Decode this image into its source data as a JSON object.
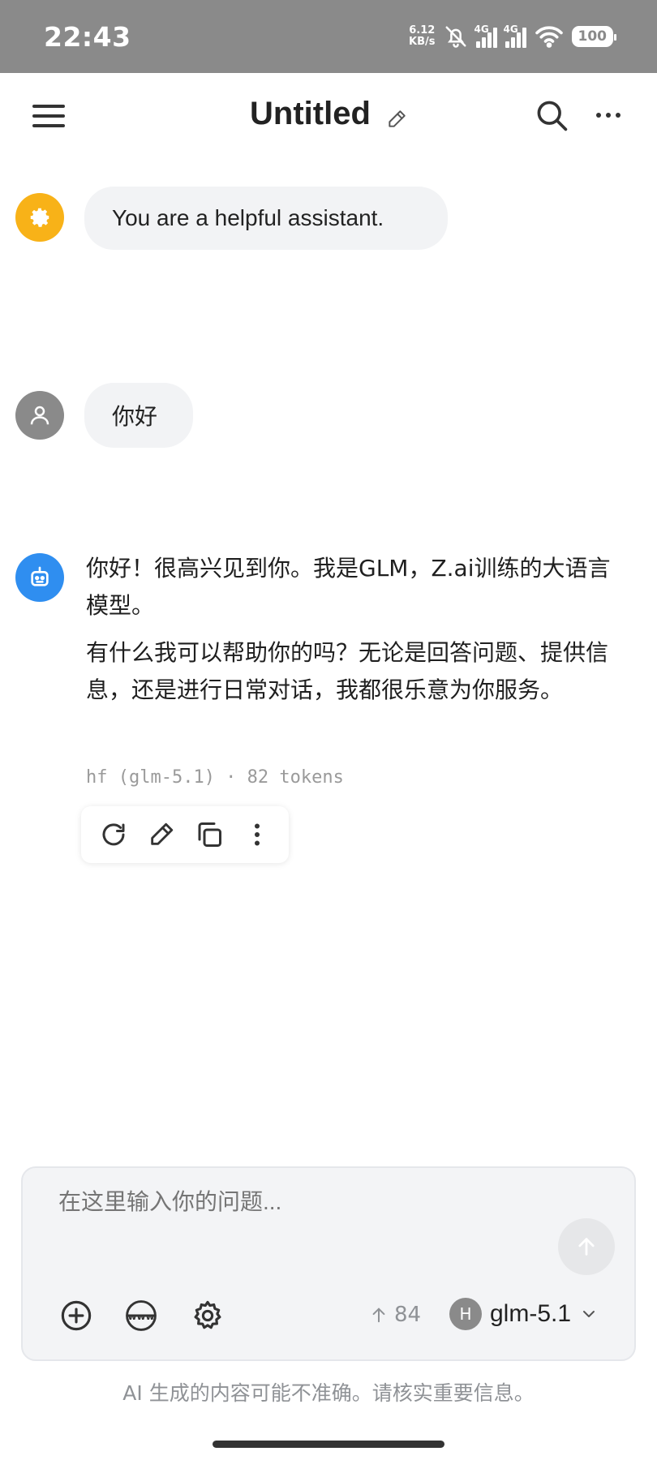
{
  "status_bar": {
    "time": "22:43",
    "net_speed_value": "6.12",
    "net_speed_unit": "KB/s",
    "sim1_label": "4G",
    "sim2_label": "4G",
    "battery": "100"
  },
  "header": {
    "title": "Untitled"
  },
  "messages": {
    "system": {
      "text": "You are a helpful assistant."
    },
    "user": {
      "text": "你好"
    },
    "assistant": {
      "paragraph_1": "你好！很高兴见到你。我是GLM，Z.ai训练的大语言模型。",
      "paragraph_2": "有什么我可以帮助你的吗？无论是回答问题、提供信息，还是进行日常对话，我都很乐意为你服务。",
      "meta": "hf (glm-5.1) · 82 tokens"
    }
  },
  "composer": {
    "placeholder": "在这里输入你的问题...",
    "token_count": "84",
    "model_badge": "H",
    "model_name": "glm-5.1"
  },
  "footer": {
    "disclaimer": "AI 生成的内容可能不准确。请核实重要信息。"
  },
  "colors": {
    "system_avatar": "#f8b218",
    "user_avatar": "#8a8a8a",
    "assistant_avatar": "#2f8ef0",
    "status_bar": "#8a8a8a"
  }
}
